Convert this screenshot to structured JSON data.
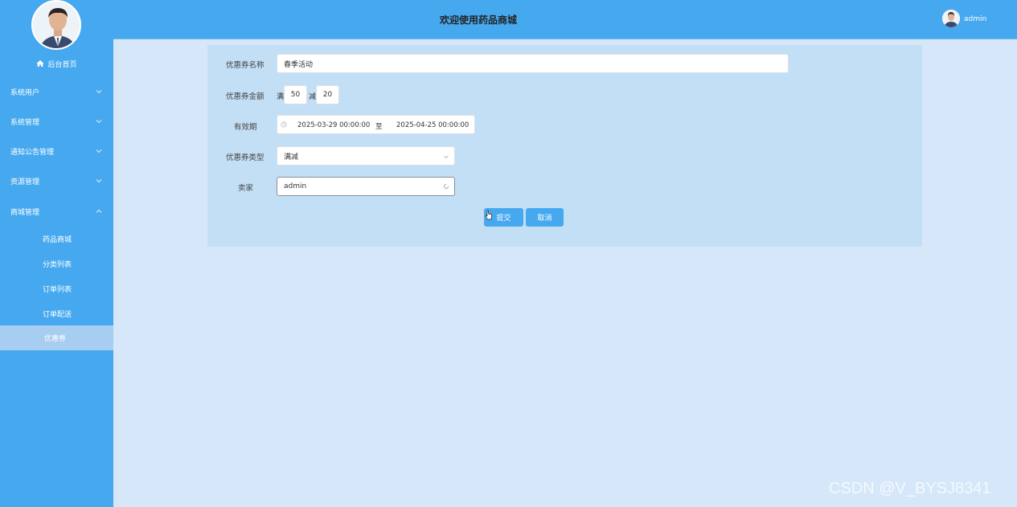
{
  "header": {
    "title": "欢迎使用药品商城",
    "user_name": "admin"
  },
  "sidebar": {
    "home_label": "后台首页",
    "groups": [
      {
        "label": "系统用户"
      },
      {
        "label": "系统管理"
      },
      {
        "label": "通知公告管理"
      },
      {
        "label": "资源管理"
      },
      {
        "label": "商城管理"
      }
    ],
    "sub_items": [
      {
        "label": "药品商城"
      },
      {
        "label": "分类列表"
      },
      {
        "label": "订单列表"
      },
      {
        "label": "订单配送"
      },
      {
        "label": "优惠券"
      }
    ]
  },
  "form": {
    "name_label": "优惠券名称",
    "name_value": "春季活动",
    "amount_label": "优惠券金额",
    "full_text": "满",
    "full_value": "50",
    "minus_text": "减",
    "minus_value": "20",
    "period_label": "有效期",
    "start_date": "2025-03-29 00:00:00",
    "range_sep": "至",
    "end_date": "2025-04-25 00:00:00",
    "type_label": "优惠券类型",
    "type_value": "满减",
    "seller_label": "卖家",
    "seller_value": "admin",
    "submit_label": "提交",
    "cancel_label": "取消"
  },
  "watermark": "CSDN @V_BYSJ8341",
  "colors": {
    "primary": "#46a9ef",
    "panel": "#c3dff6",
    "background": "#d5e7f9"
  }
}
